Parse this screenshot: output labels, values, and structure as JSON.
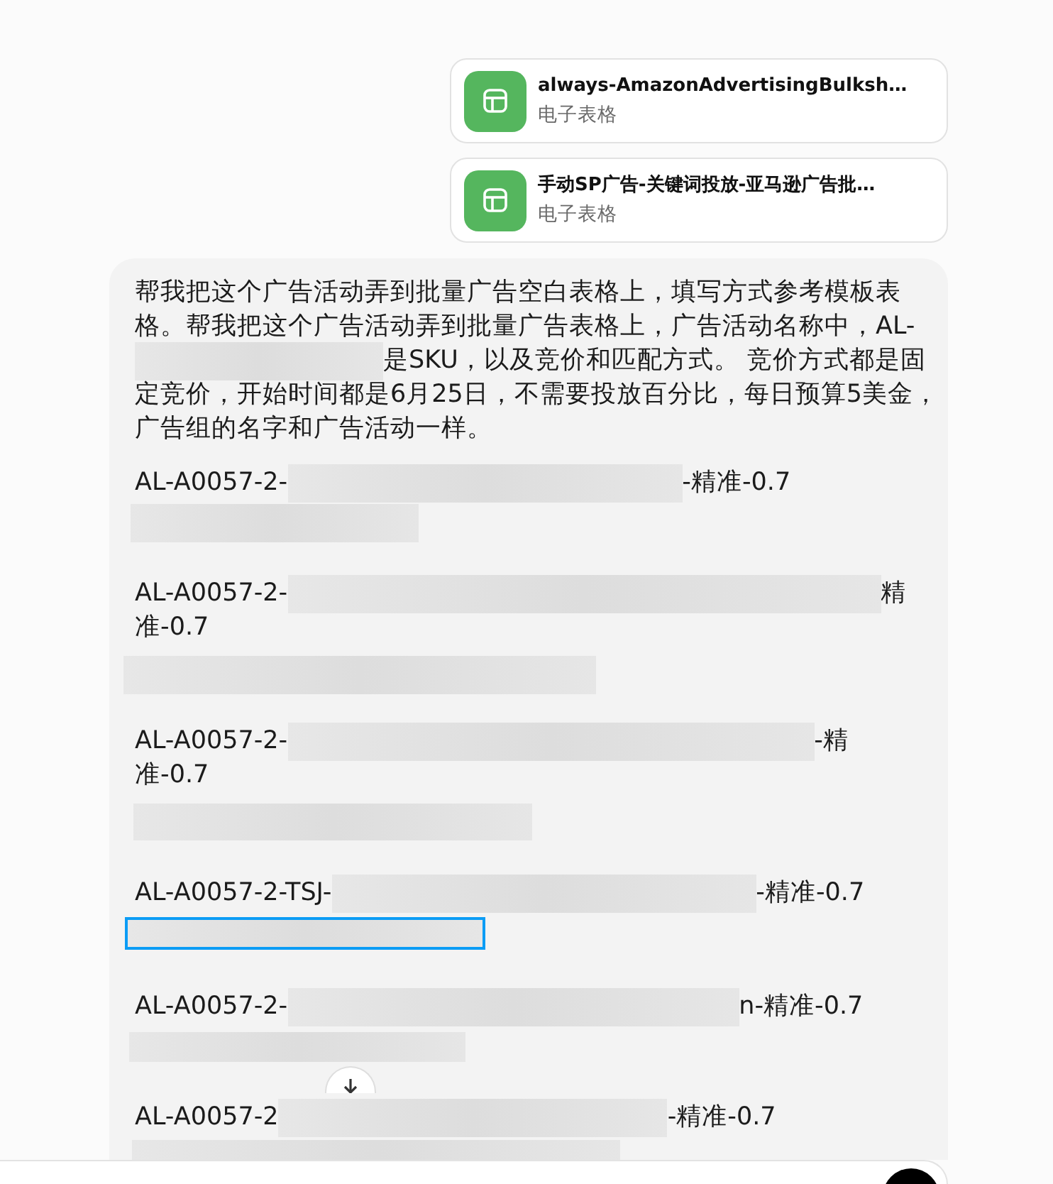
{
  "attachments": [
    {
      "name": "always-AmazonAdvertisingBulksh…",
      "type": "电子表格"
    },
    {
      "name": "手动SP广告-关键词投放-亚马逊广告批…",
      "type": "电子表格"
    }
  ],
  "message": {
    "intro": [
      {
        "kind": "paragraph",
        "text": "帮我把这个广告活动弄到批量广告空白表格上，填写方式参考模板表格。帮我把这个广告活动弄到批量广告表格上，广告活动名称中，AL-"
      },
      {
        "kind": "line",
        "parts": [
          {
            "kind": "redaction",
            "selected": false
          },
          {
            "kind": "text",
            "text": "是SKU，以及竞价和匹配方式。 竞价方式都是固"
          }
        ]
      },
      {
        "kind": "paragraph",
        "text": "定竞价，开始时间都是6月25日，不需要投放百分比，每日预算5美金，广告组的名字和广告活动一样。"
      }
    ],
    "entries": [
      {
        "lines": [
          {
            "parts": [
              {
                "kind": "text",
                "text": "AL-A0057-2-"
              },
              {
                "kind": "redaction",
                "selected": false
              },
              {
                "kind": "text",
                "text": "-精准-0.7"
              }
            ]
          },
          {
            "parts": [
              {
                "kind": "redaction",
                "selected": false
              }
            ]
          }
        ]
      },
      {
        "lines": [
          {
            "parts": [
              {
                "kind": "text",
                "text": "AL-A0057-2-"
              },
              {
                "kind": "redaction",
                "selected": false
              },
              {
                "kind": "text",
                "text": "精"
              }
            ]
          },
          {
            "parts": [
              {
                "kind": "text",
                "text": "准-0.7"
              }
            ]
          },
          {
            "parts": [
              {
                "kind": "redaction",
                "selected": false
              }
            ]
          }
        ]
      },
      {
        "lines": [
          {
            "parts": [
              {
                "kind": "text",
                "text": "AL-A0057-2-"
              },
              {
                "kind": "redaction",
                "selected": false
              },
              {
                "kind": "text",
                "text": "-精"
              }
            ]
          },
          {
            "parts": [
              {
                "kind": "text",
                "text": "准-0.7"
              }
            ]
          },
          {
            "parts": [
              {
                "kind": "redaction",
                "selected": false
              }
            ]
          }
        ]
      },
      {
        "lines": [
          {
            "parts": [
              {
                "kind": "text",
                "text": "AL-A0057-2-TSJ-"
              },
              {
                "kind": "redaction",
                "selected": false
              },
              {
                "kind": "text",
                "text": "-精准-0.7"
              }
            ]
          },
          {
            "parts": [
              {
                "kind": "redaction",
                "selected": true
              }
            ]
          }
        ]
      },
      {
        "lines": [
          {
            "parts": [
              {
                "kind": "text",
                "text": "AL-A0057-2-"
              },
              {
                "kind": "redaction",
                "selected": false
              },
              {
                "kind": "text",
                "text": "n-精准-0.7"
              }
            ]
          },
          {
            "parts": [
              {
                "kind": "redaction",
                "selected": false
              }
            ]
          }
        ]
      },
      {
        "lines": [
          {
            "parts": [
              {
                "kind": "text",
                "text": "AL-A0057-2"
              },
              {
                "kind": "redaction",
                "selected": false
              },
              {
                "kind": "text",
                "text": "-精准-0.7"
              }
            ]
          },
          {
            "parts": [
              {
                "kind": "redaction",
                "selected": false
              }
            ]
          }
        ]
      }
    ]
  }
}
